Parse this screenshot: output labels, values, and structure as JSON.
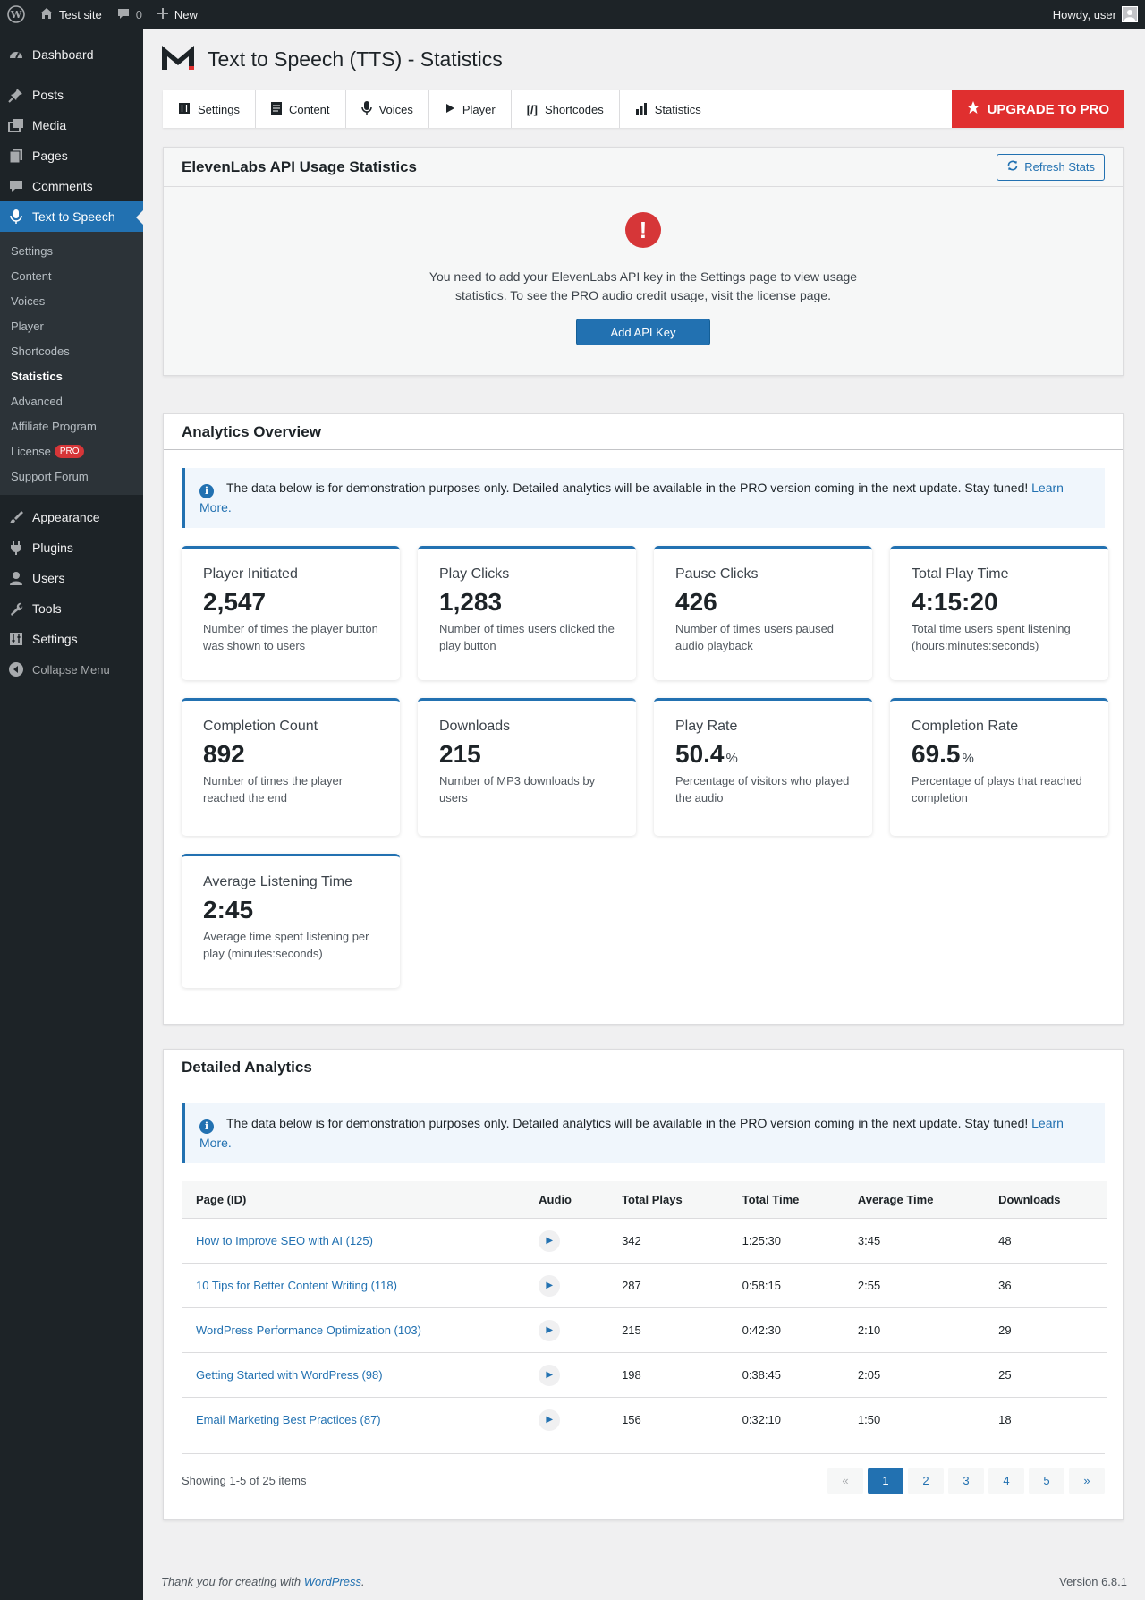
{
  "admin_bar": {
    "site_name": "Test site",
    "comments_count": "0",
    "new_label": "New",
    "howdy": "Howdy, user"
  },
  "sidebar": {
    "top_items": [
      {
        "label": "Dashboard",
        "icon": "dashboard-icon"
      }
    ],
    "items": [
      {
        "label": "Posts",
        "icon": "pin-icon"
      },
      {
        "label": "Media",
        "icon": "media-icon"
      },
      {
        "label": "Pages",
        "icon": "page-icon"
      },
      {
        "label": "Comments",
        "icon": "comment-icon"
      },
      {
        "label": "Text to Speech",
        "icon": "microphone-icon"
      }
    ],
    "submenu": [
      "Settings",
      "Content",
      "Voices",
      "Player",
      "Shortcodes",
      "Statistics",
      "Advanced",
      "Affiliate Program",
      "License",
      "Support Forum"
    ],
    "license_badge": "PRO",
    "lower_items": [
      {
        "label": "Appearance",
        "icon": "brush-icon"
      },
      {
        "label": "Plugins",
        "icon": "plugin-icon"
      },
      {
        "label": "Users",
        "icon": "user-icon"
      },
      {
        "label": "Tools",
        "icon": "wrench-icon"
      },
      {
        "label": "Settings",
        "icon": "settings-icon"
      }
    ],
    "collapse": "Collapse Menu"
  },
  "page": {
    "title": "Text to Speech (TTS) - Statistics"
  },
  "tabs": [
    {
      "label": "Settings",
      "icon": "settings-sliders-icon"
    },
    {
      "label": "Content",
      "icon": "document-icon"
    },
    {
      "label": "Voices",
      "icon": "microphone-icon"
    },
    {
      "label": "Player",
      "icon": "play-icon"
    },
    {
      "label": "Shortcodes",
      "icon": "shortcode-icon"
    },
    {
      "label": "Statistics",
      "icon": "bar-chart-icon"
    }
  ],
  "upgrade_label": "UPGRADE TO PRO",
  "api_card": {
    "title": "ElevenLabs API Usage Statistics",
    "refresh_label": "Refresh Stats",
    "message": "You need to add your ElevenLabs API key in the Settings page to view usage statistics. To see the PRO audio credit usage, visit the license page.",
    "button": "Add API Key"
  },
  "analytics": {
    "title": "Analytics Overview",
    "notice": "The data below is for demonstration purposes only. Detailed analytics will be available in the PRO version coming in the next update. Stay tuned!",
    "notice_link": "Learn More.",
    "stats": [
      {
        "label": "Player Initiated",
        "value": "2,547",
        "unit": "",
        "desc": "Number of times the player button was shown to users"
      },
      {
        "label": "Play Clicks",
        "value": "1,283",
        "unit": "",
        "desc": "Number of times users clicked the play button"
      },
      {
        "label": "Pause Clicks",
        "value": "426",
        "unit": "",
        "desc": "Number of times users paused audio playback"
      },
      {
        "label": "Total Play Time",
        "value": "4:15:20",
        "unit": "",
        "desc": "Total time users spent listening (hours:minutes:seconds)"
      },
      {
        "label": "Completion Count",
        "value": "892",
        "unit": "",
        "desc": "Number of times the player reached the end"
      },
      {
        "label": "Downloads",
        "value": "215",
        "unit": "",
        "desc": "Number of MP3 downloads by users"
      },
      {
        "label": "Play Rate",
        "value": "50.4",
        "unit": "%",
        "desc": "Percentage of visitors who played the audio"
      },
      {
        "label": "Completion Rate",
        "value": "69.5",
        "unit": "%",
        "desc": "Percentage of plays that reached completion"
      },
      {
        "label": "Average Listening Time",
        "value": "2:45",
        "unit": "",
        "desc": "Average time spent listening per play (minutes:seconds)"
      }
    ]
  },
  "detailed": {
    "title": "Detailed Analytics",
    "notice": "The data below is for demonstration purposes only. Detailed analytics will be available in the PRO version coming in the next update. Stay tuned!",
    "notice_link": "Learn More.",
    "columns": [
      "Page (ID)",
      "Audio",
      "Total Plays",
      "Total Time",
      "Average Time",
      "Downloads"
    ],
    "rows": [
      [
        "How to Improve SEO with AI (125)",
        "342",
        "1:25:30",
        "3:45",
        "48"
      ],
      [
        "10 Tips for Better Content Writing (118)",
        "287",
        "0:58:15",
        "2:55",
        "36"
      ],
      [
        "WordPress Performance Optimization (103)",
        "215",
        "0:42:30",
        "2:10",
        "29"
      ],
      [
        "Getting Started with WordPress (98)",
        "198",
        "0:38:45",
        "2:05",
        "25"
      ],
      [
        "Email Marketing Best Practices (87)",
        "156",
        "0:32:10",
        "1:50",
        "18"
      ]
    ],
    "showing": "Showing 1-5 of 25 items",
    "pages": [
      "«",
      "1",
      "2",
      "3",
      "4",
      "5",
      "»"
    ]
  },
  "footer": {
    "thanks_prefix": "Thank you for creating with ",
    "thanks_link": "WordPress",
    "thanks_suffix": ".",
    "version": "Version 6.8.1"
  }
}
